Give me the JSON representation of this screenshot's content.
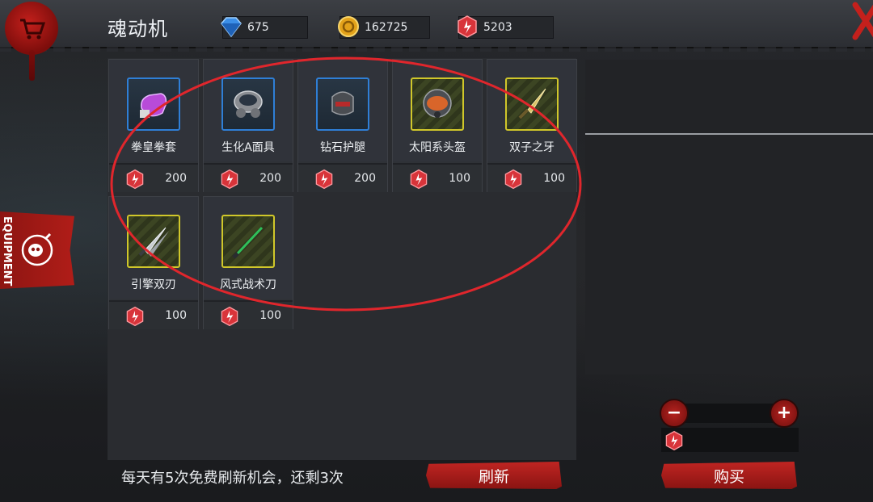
{
  "header": {
    "title": "魂动机",
    "currencies": {
      "gem": "675",
      "gold": "162725",
      "soul": "5203"
    }
  },
  "side_tab": {
    "label": "EQUIPMENT"
  },
  "items": [
    {
      "name": "拳皇拳套",
      "price": "200",
      "frame": "blue",
      "icon": "gauntlet-icon"
    },
    {
      "name": "生化A面具",
      "price": "200",
      "frame": "blue",
      "icon": "gas-mask-icon"
    },
    {
      "name": "钻石护腿",
      "price": "200",
      "frame": "blue",
      "icon": "leg-armor-icon"
    },
    {
      "name": "太阳系头盔",
      "price": "100",
      "frame": "yellow",
      "icon": "helmet-icon"
    },
    {
      "name": "双子之牙",
      "price": "100",
      "frame": "yellow",
      "icon": "dagger-icon"
    },
    {
      "name": "引擎双刃",
      "price": "100",
      "frame": "yellow",
      "icon": "twin-blades-icon"
    },
    {
      "name": "风式战术刀",
      "price": "100",
      "frame": "yellow",
      "icon": "tactical-knife-icon"
    }
  ],
  "footer": {
    "refresh_note": "每天有5次免费刷新机会，还剩3次",
    "refresh_label": "刷新",
    "buy_label": "购买"
  },
  "colors": {
    "accent_red": "#b01d18",
    "blue_frame": "#2f7fd6",
    "yellow_frame": "#d0c72a",
    "annotation": "#e0262c"
  }
}
